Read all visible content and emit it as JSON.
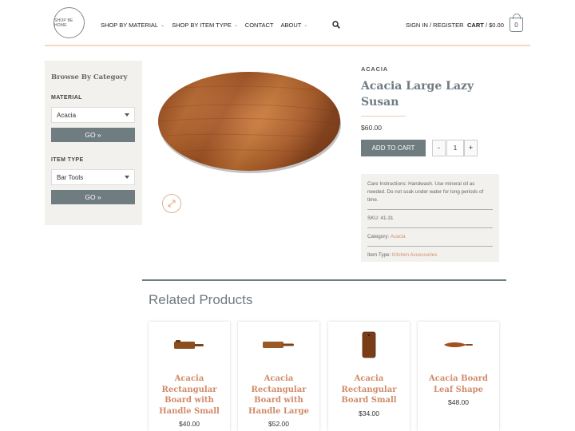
{
  "header": {
    "logo_text": "SHOP BE HOME",
    "nav": [
      {
        "label": "SHOP BY MATERIAL",
        "has_caret": true
      },
      {
        "label": "SHOP BY ITEM TYPE",
        "has_caret": true
      },
      {
        "label": "CONTACT",
        "has_caret": false
      },
      {
        "label": "ABOUT",
        "has_caret": true
      }
    ],
    "search_icon": "search-icon",
    "signin_label": "SIGN IN / REGISTER",
    "cart_label": "CART",
    "cart_total": "/ $0.00",
    "cart_count": "0"
  },
  "sidebar": {
    "title": "Browse By Category",
    "material_label": "MATERIAL",
    "material_value": "Acacia",
    "go_label": "GO »",
    "itemtype_label": "ITEM TYPE",
    "itemtype_value": "Bar Tools",
    "go2_label": "GO »"
  },
  "product": {
    "category": "ACACIA",
    "title": "Acacia Large Lazy Susan",
    "price": "$60.00",
    "add_to_cart": "ADD TO CART",
    "qty_minus": "-",
    "qty_value": "1",
    "qty_plus": "+",
    "care": "Care Instructions: Handwash. Use mineral oil as needed. Do not soak under water for long periods of time.",
    "sku": "SKU: 41-31",
    "category_label": "Category:",
    "category_link": "Acacia",
    "item_type_label": "Item Type:",
    "item_type_link": "Kitchen Accessories"
  },
  "related": {
    "title": "Related Products",
    "items": [
      {
        "name": "Acacia Rectangular Board with Handle Small",
        "price": "$40.00"
      },
      {
        "name": "Acacia Rectangular Board with Handle Large",
        "price": "$52.00"
      },
      {
        "name": "Acacia Rectangular Board Small",
        "price": "$34.00"
      },
      {
        "name": "Acacia Board Leaf Shape",
        "price": "$48.00"
      }
    ]
  },
  "colors": {
    "accent": "#d08b68",
    "button": "#6f7c80",
    "panel": "#f3f1ee",
    "header_rule": "#f1d9b9"
  }
}
